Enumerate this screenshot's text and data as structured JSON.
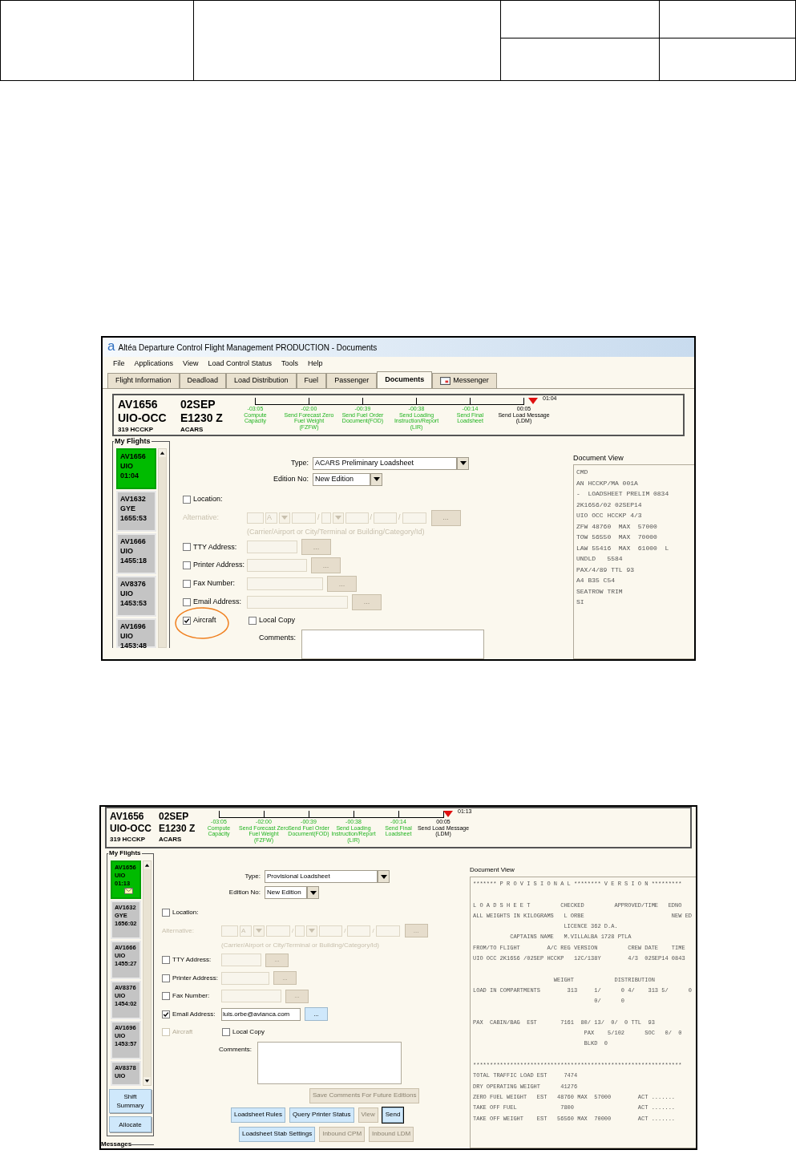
{
  "screenshots": [
    {
      "logo": "a",
      "window_title": "Altéa Departure Control Flight Management PRODUCTION - Documents",
      "menu": [
        "File",
        "Applications",
        "View",
        "Load Control Status",
        "Tools",
        "Help"
      ],
      "tabs": [
        {
          "label": "Flight Information",
          "selected": false,
          "has_icon": false
        },
        {
          "label": "Deadload",
          "selected": false,
          "has_icon": false
        },
        {
          "label": "Load Distribution",
          "selected": false,
          "has_icon": false
        },
        {
          "label": "Fuel",
          "selected": false,
          "has_icon": false
        },
        {
          "label": "Passenger",
          "selected": false,
          "has_icon": false
        },
        {
          "label": "Documents",
          "selected": true,
          "has_icon": false
        },
        {
          "label": "Messenger",
          "selected": false,
          "has_icon": true
        }
      ],
      "flight": {
        "number": "AV1656",
        "route": "UIO-OCC",
        "aircraft": "319 HCCKP",
        "date": "02SEP",
        "departure": "E1230 Z",
        "channel": "ACARS"
      },
      "timeline": {
        "milestones": [
          {
            "time": "-03:05",
            "lines": [
              "Compute",
              "Capacity"
            ],
            "done": true
          },
          {
            "time": "-02:00",
            "lines": [
              "Send Forecast Zero",
              "Fuel Weight",
              "(FZFW)"
            ],
            "done": true
          },
          {
            "time": "-00:39",
            "lines": [
              "Send Fuel Order",
              "Document(FOD)"
            ],
            "done": true
          },
          {
            "time": "-00:38",
            "lines": [
              "Send Loading",
              "Instruction/Report",
              "(LIR)"
            ],
            "done": true
          },
          {
            "time": "-00:14",
            "lines": [
              "Send Final",
              "Loadsheet"
            ],
            "done": true
          },
          {
            "time": "00:05",
            "lines": [
              "Send Load Message",
              "(LDM)"
            ],
            "done": false
          }
        ],
        "marker_time": "01:04"
      },
      "my_flights": {
        "title": "My Flights",
        "items": [
          {
            "number": "AV1656",
            "station": "UIO",
            "time": "01:04",
            "selected": true,
            "mail": false
          },
          {
            "number": "AV1632",
            "station": "GYE",
            "time": "1655:53",
            "selected": false,
            "mail": false
          },
          {
            "number": "AV1666",
            "station": "UIO",
            "time": "1455:18",
            "selected": false,
            "mail": false
          },
          {
            "number": "AV8376",
            "station": "UIO",
            "time": "1453:53",
            "selected": false,
            "mail": false
          },
          {
            "number": "AV1696",
            "station": "UIO",
            "time": "1453:48",
            "selected": false,
            "mail": false
          }
        ]
      },
      "form": {
        "type_label": "Type:",
        "type_value": "ACARS Preliminary Loadsheet",
        "edition_label": "Edition No:",
        "edition_value": "New Edition",
        "location": {
          "label": "Location:",
          "checked": false
        },
        "alternative": {
          "label": "Alternative:",
          "code": "A",
          "separators": [
            "/",
            "/",
            "/"
          ],
          "button": "...",
          "hint": "(Carrier/Airport or City/Terminal or Building/Category/Id)"
        },
        "addresses": [
          {
            "label": "TTY Address:",
            "checked": false,
            "button": "..."
          },
          {
            "label": "Printer Address:",
            "checked": false,
            "button": "..."
          },
          {
            "label": "Fax Number:",
            "checked": false,
            "button": "..."
          },
          {
            "label": "Email Address:",
            "checked": false,
            "button": "..."
          }
        ],
        "aircraft": {
          "label": "Aircraft",
          "checked": true,
          "disabled": false,
          "circled": true
        },
        "local_copy": {
          "label": "Local Copy",
          "checked": false
        },
        "comments_label": "Comments:"
      },
      "document_view": {
        "title": "Document View",
        "lines": [
          {
            "text": "CMD",
            "spaced": false
          },
          {
            "text": "AN HCCKP/MA 001A",
            "spaced": false
          },
          {
            "text": "-  LOADSHEET PRELIM 0834",
            "spaced": false
          },
          {
            "text": "2K1656/02 02SEP14",
            "spaced": false
          },
          {
            "text": "UIO OCC HCCKP 4/3",
            "spaced": false
          },
          {
            "text": "ZFW 48760  MAX  57000",
            "spaced": false
          },
          {
            "text": "TOW 56550  MAX  70000",
            "spaced": false
          },
          {
            "text": "LAW 55416  MAX  61000  L",
            "spaced": false
          },
          {
            "text": "UNDLD   5584",
            "spaced": false
          },
          {
            "text": "PAX/4/89 TTL 93",
            "spaced": false
          },
          {
            "text": "A4 B35 C54",
            "spaced": false
          },
          {
            "text": "SEATROW TRIM",
            "spaced": false
          },
          {
            "text": "SI",
            "spaced": false
          }
        ]
      }
    },
    {
      "flight": {
        "number": "AV1656",
        "route": "UIO-OCC",
        "aircraft": "319 HCCKP",
        "date": "02SEP",
        "departure": "E1230 Z",
        "channel": "ACARS"
      },
      "timeline": {
        "milestones": [
          {
            "time": "-03:05",
            "lines": [
              "Compute",
              "Capacity"
            ],
            "done": true
          },
          {
            "time": "-02:00",
            "lines": [
              "Send Forecast Zero",
              "Fuel Weight",
              "(FZFW)"
            ],
            "done": true
          },
          {
            "time": "-00:39",
            "lines": [
              "Send Fuel Order",
              "Document(FOD)"
            ],
            "done": true
          },
          {
            "time": "-00:38",
            "lines": [
              "Send Loading",
              "Instruction/Report",
              "(LIR)"
            ],
            "done": true
          },
          {
            "time": "-00:14",
            "lines": [
              "Send Final",
              "Loadsheet"
            ],
            "done": true
          },
          {
            "time": "00:05",
            "lines": [
              "Send Load Message",
              "(LDM)"
            ],
            "done": false
          }
        ],
        "marker_time": "01:13"
      },
      "my_flights": {
        "title": "My Flights",
        "items": [
          {
            "number": "AV1656",
            "station": "UIO",
            "time": "01:13",
            "selected": true,
            "mail": true
          },
          {
            "number": "AV1632",
            "station": "GYE",
            "time": "1656:02",
            "selected": false,
            "mail": false
          },
          {
            "number": "AV1666",
            "station": "UIO",
            "time": "1455:27",
            "selected": false,
            "mail": false
          },
          {
            "number": "AV8376",
            "station": "UIO",
            "time": "1454:02",
            "selected": false,
            "mail": false
          },
          {
            "number": "AV1696",
            "station": "UIO",
            "time": "1453:57",
            "selected": false,
            "mail": false
          },
          {
            "number": "AV8378",
            "station": "UIO",
            "selected": false,
            "mail": false
          }
        ]
      },
      "side_buttons": [
        "Shift Summary",
        "Allocate"
      ],
      "messages_title": "Messages",
      "form": {
        "type_label": "Type:",
        "type_value": "Provisional Loadsheet",
        "edition_label": "Edition No:",
        "edition_value": "New Edition",
        "location": {
          "label": "Location:",
          "checked": false
        },
        "alternative": {
          "label": "Alternative:",
          "code": "A",
          "separators": [
            "/",
            "/",
            "/"
          ],
          "button": "...",
          "hint": "(Carrier/Airport or City/Terminal or Building/Category/Id)"
        },
        "addresses": [
          {
            "label": "TTY Address:",
            "checked": false,
            "button": "..."
          },
          {
            "label": "Printer Address:",
            "checked": false,
            "button": "..."
          },
          {
            "label": "Fax Number:",
            "checked": false,
            "button": "..."
          },
          {
            "label": "Email Address:",
            "checked": true,
            "value": "luis.orbe@avianca.com",
            "button": "..."
          }
        ],
        "aircraft": {
          "label": "Aircraft",
          "checked": false,
          "disabled": true,
          "circled": false
        },
        "local_copy": {
          "label": "Local Copy",
          "checked": false
        },
        "comments_label": "Comments:",
        "button_rows": [
          [
            {
              "label": "Save Comments For Future Editions",
              "disabled": true,
              "focused": false
            }
          ],
          [
            {
              "label": "Loadsheet Rules",
              "disabled": false,
              "focused": false
            },
            {
              "label": "Query Printer Status",
              "disabled": false,
              "focused": false
            },
            {
              "label": "View",
              "disabled": true,
              "focused": false
            },
            {
              "label": "Send",
              "disabled": false,
              "focused": true
            }
          ],
          [
            {
              "label": "Loadsheet Stab Settings",
              "disabled": false,
              "focused": false
            },
            {
              "label": "Inbound CPM",
              "disabled": true,
              "focused": false
            },
            {
              "label": "Inbound LDM",
              "disabled": true,
              "focused": false
            }
          ]
        ]
      },
      "document_view": {
        "title": "Document View",
        "lines": [
          {
            "text": "******* P R O V I S I O N A L ******** V E R S I O N *********",
            "spaced": false
          },
          {
            "text": "L O A D S H E E T         CHECKED         APPROVED/TIME   EDNO",
            "spaced": true
          },
          {
            "text": "ALL WEIGHTS IN KILOGRAMS   L ORBE                          NEW ED",
            "spaced": false
          },
          {
            "text": "                           LICENCE 362 D.A.",
            "spaced": false
          },
          {
            "text": "           CAPTAINS NAME   M.VILLALBA 1728 PTLA",
            "spaced": false
          },
          {
            "text": "FROM/TO FLIGHT        A/C REG VERSION         CREW DATE    TIME",
            "spaced": false
          },
          {
            "text": "UIO OCC 2K1656 /02SEP HCCKP   12C/138Y        4/3  02SEP14 0843",
            "spaced": false
          },
          {
            "text": "                        WEIGHT            DISTRIBUTION",
            "spaced": true
          },
          {
            "text": "LOAD IN COMPARTMENTS        313     1/      0 4/    313 5/      0",
            "spaced": false
          },
          {
            "text": "                                    0/      0",
            "spaced": false
          },
          {
            "text": "PAX  CABIN/BAG  EST       7161  80/ 13/  0/  0 TTL  93",
            "spaced": true
          },
          {
            "text": "                                 PAX    5/102      SOC   0/  0",
            "spaced": false
          },
          {
            "text": "                                 BLKD  0",
            "spaced": false
          },
          {
            "text": "**************************************************************",
            "spaced": true
          },
          {
            "text": "TOTAL TRAFFIC LOAD EST     7474",
            "spaced": false
          },
          {
            "text": "DRY OPERATING WEIGHT      41276",
            "spaced": false
          },
          {
            "text": "ZERO FUEL WEIGHT   EST   48760 MAX  57000        ACT .......",
            "spaced": false
          },
          {
            "text": "TAKE OFF FUEL             7800                   ACT .......",
            "spaced": false
          },
          {
            "text": "TAKE OFF WEIGHT    EST   56560 MAX  70000        ACT .......",
            "spaced": false
          }
        ]
      }
    }
  ]
}
